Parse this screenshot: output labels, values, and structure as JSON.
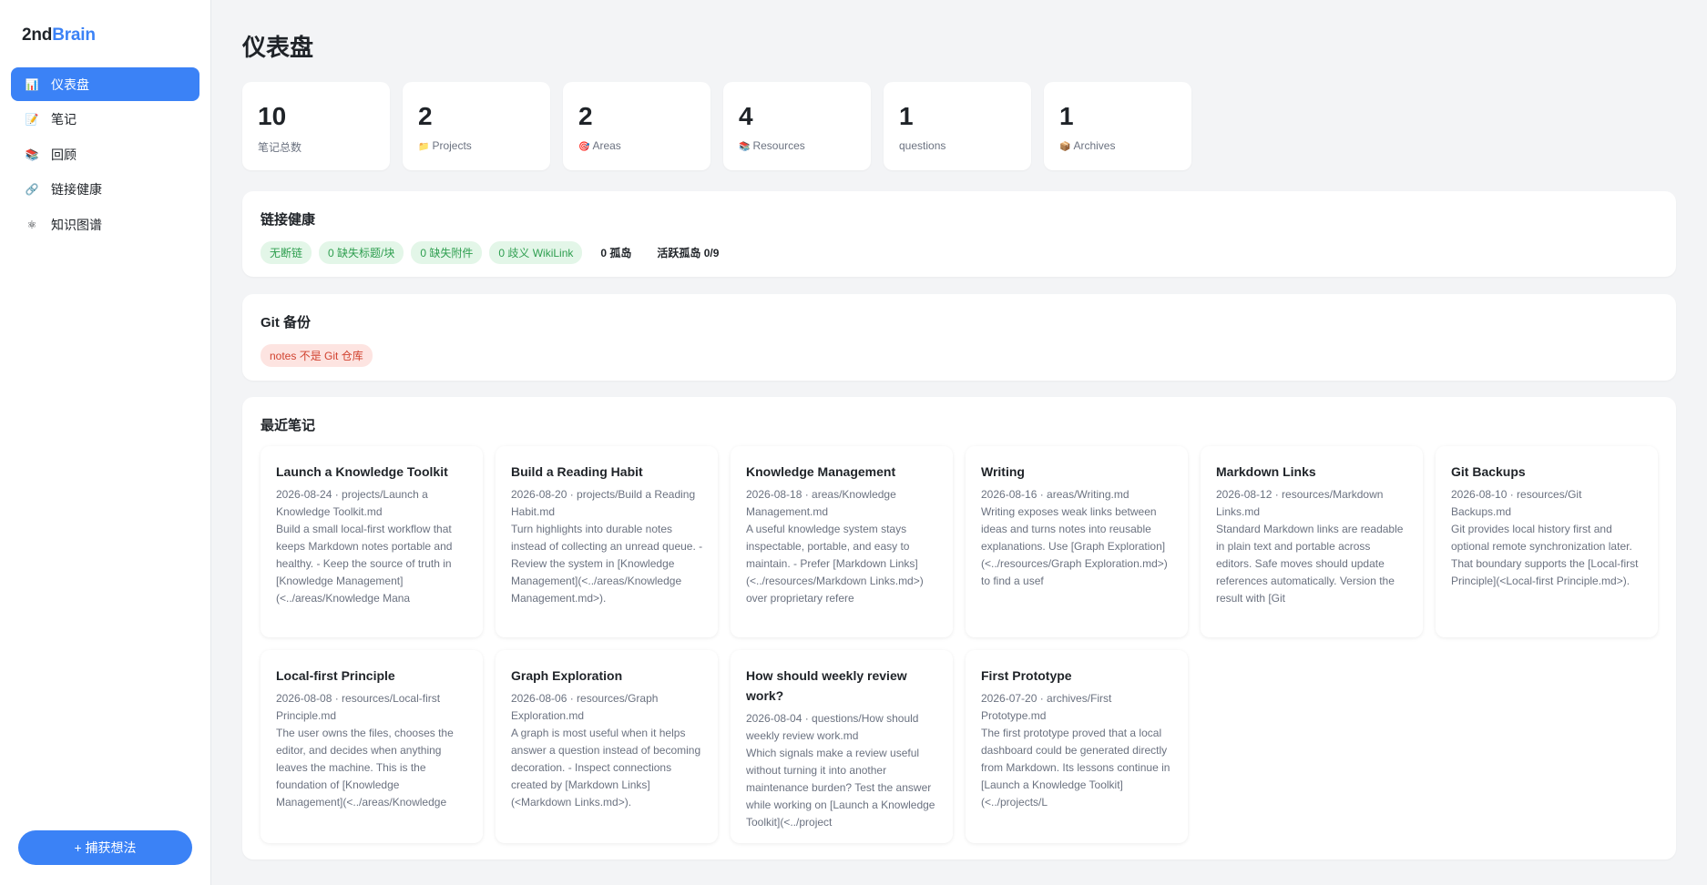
{
  "brand": {
    "part1": "2nd",
    "part2": "Brain"
  },
  "sidebar": {
    "items": [
      {
        "icon": "📊",
        "label": "仪表盘",
        "active": true
      },
      {
        "icon": "📝",
        "label": "笔记",
        "active": false
      },
      {
        "icon": "📚",
        "label": "回顾",
        "active": false
      },
      {
        "icon": "🔗",
        "label": "链接健康",
        "active": false
      },
      {
        "icon": "⚛",
        "label": "知识图谱",
        "active": false
      }
    ],
    "capture_button": "+ 捕获想法"
  },
  "page": {
    "title": "仪表盘"
  },
  "stats": [
    {
      "value": "10",
      "icon": "",
      "label": "笔记总数"
    },
    {
      "value": "2",
      "icon": "📁",
      "label": "Projects"
    },
    {
      "value": "2",
      "icon": "🎯",
      "label": "Areas"
    },
    {
      "value": "4",
      "icon": "📚",
      "label": "Resources"
    },
    {
      "value": "1",
      "icon": "",
      "label": "questions"
    },
    {
      "value": "1",
      "icon": "📦",
      "label": "Archives"
    }
  ],
  "link_health": {
    "title": "链接健康",
    "badges": [
      "无断链",
      "0 缺失标题/块",
      "0 缺失附件",
      "0 歧义 WikiLink"
    ],
    "orphans": "0 孤岛",
    "active_orphans": "活跃孤岛 0/9"
  },
  "git": {
    "title": "Git 备份",
    "status": "notes 不是 Git 仓库"
  },
  "recent": {
    "title": "最近笔记",
    "notes": [
      {
        "title": "Launch a Knowledge Toolkit",
        "meta": "2026-08-24 · projects/Launch a Knowledge Toolkit.md",
        "body": "Build a small local-first workflow that keeps Markdown notes portable and healthy. - Keep the source of truth in [Knowledge Management](<../areas/Knowledge Mana"
      },
      {
        "title": "Build a Reading Habit",
        "meta": "2026-08-20 · projects/Build a Reading Habit.md",
        "body": "Turn highlights into durable notes instead of collecting an unread queue. - Review the system in [Knowledge Management](<../areas/Knowledge Management.md>)."
      },
      {
        "title": "Knowledge Management",
        "meta": "2026-08-18 · areas/Knowledge Management.md",
        "body": "A useful knowledge system stays inspectable, portable, and easy to maintain. - Prefer [Markdown Links](<../resources/Markdown Links.md>) over proprietary refere"
      },
      {
        "title": "Writing",
        "meta": "2026-08-16 · areas/Writing.md",
        "body": "Writing exposes weak links between ideas and turns notes into reusable explanations. Use [Graph Exploration](<../resources/Graph Exploration.md>) to find a usef"
      },
      {
        "title": "Markdown Links",
        "meta": "2026-08-12 · resources/Markdown Links.md",
        "body": "Standard Markdown links are readable in plain text and portable across editors. Safe moves should update references automatically. Version the result with [Git"
      },
      {
        "title": "Git Backups",
        "meta": "2026-08-10 · resources/Git Backups.md",
        "body": "Git provides local history first and optional remote synchronization later. That boundary supports the [Local-first Principle](<Local-first Principle.md>)."
      },
      {
        "title": "Local-first Principle",
        "meta": "2026-08-08 · resources/Local-first Principle.md",
        "body": "The user owns the files, chooses the editor, and decides when anything leaves the machine. This is the foundation of [Knowledge Management](<../areas/Knowledge"
      },
      {
        "title": "Graph Exploration",
        "meta": "2026-08-06 · resources/Graph Exploration.md",
        "body": "A graph is most useful when it helps answer a question instead of becoming decoration. - Inspect connections created by [Markdown Links](<Markdown Links.md>)."
      },
      {
        "title": "How should weekly review work?",
        "meta": "2026-08-04 · questions/How should weekly review work.md",
        "body": "Which signals make a review useful without turning it into another maintenance burden? Test the answer while working on [Launch a Knowledge Toolkit](<../project"
      },
      {
        "title": "First Prototype",
        "meta": "2026-07-20 · archives/First Prototype.md",
        "body": "The first prototype proved that a local dashboard could be generated directly from Markdown. Its lessons continue in [Launch a Knowledge Toolkit](<../projects/L"
      }
    ]
  }
}
